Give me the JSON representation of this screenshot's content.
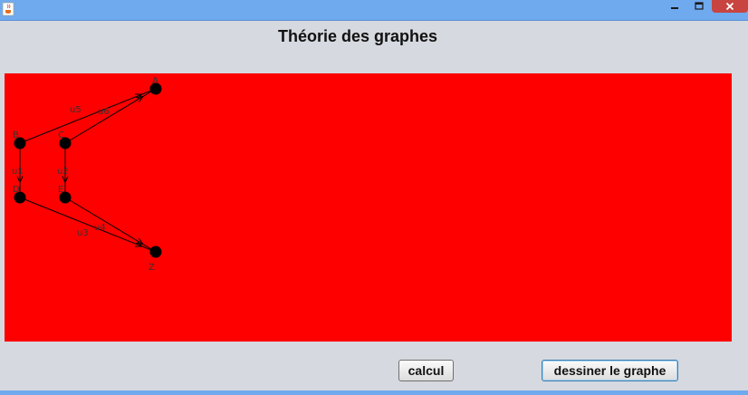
{
  "window": {
    "icon": "java-cup-icon",
    "controls": [
      "minimize-icon",
      "maximize-icon",
      "close-icon"
    ],
    "accent_color": "#6fa9ee",
    "close_color": "#c84440"
  },
  "header": {
    "title": "Théorie des graphes"
  },
  "graph": {
    "background_color": "#ff0000",
    "node_color": "#000000",
    "nodes": [
      {
        "id": "A",
        "label": "A"
      },
      {
        "id": "B",
        "label": "B"
      },
      {
        "id": "C",
        "label": "C"
      },
      {
        "id": "D",
        "label": "D"
      },
      {
        "id": "E",
        "label": "E"
      },
      {
        "id": "Z",
        "label": "Z"
      }
    ],
    "edges": [
      {
        "id": "u1",
        "label": "u1",
        "from": "B",
        "to": "D"
      },
      {
        "id": "u2",
        "label": "u2",
        "from": "C",
        "to": "E"
      },
      {
        "id": "u3",
        "label": "u3",
        "from": "D",
        "to": "Z"
      },
      {
        "id": "u4",
        "label": "u4",
        "from": "E",
        "to": "Z"
      },
      {
        "id": "u5",
        "label": "u5",
        "from": "B",
        "to": "A"
      },
      {
        "id": "u6",
        "label": "u6",
        "from": "C",
        "to": "A"
      }
    ]
  },
  "buttons": {
    "calcul": "calcul",
    "draw_graph": "dessiner le graphe"
  }
}
